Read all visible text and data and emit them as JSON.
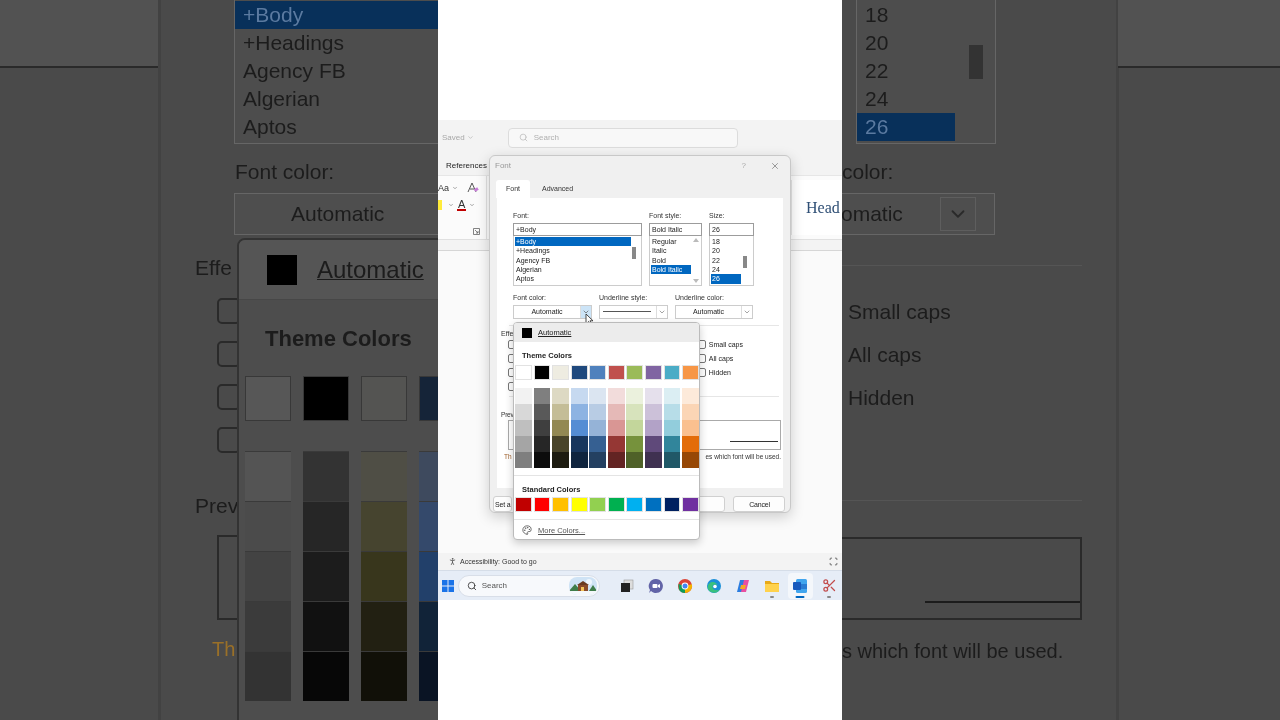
{
  "zoom_left": {
    "font_list": [
      {
        "label": "+Body",
        "selected": true
      },
      {
        "label": "+Headings",
        "selected": false
      },
      {
        "label": "Agency FB",
        "selected": false
      },
      {
        "label": "Algerian",
        "selected": false
      },
      {
        "label": "Aptos",
        "selected": false
      }
    ],
    "font_color_label": "Font color:",
    "font_color_value": "Automatic",
    "effects_label": "Effe",
    "checkboxes": [
      {
        "checked": false
      },
      {
        "checked": false
      },
      {
        "checked": false
      },
      {
        "checked": false
      }
    ],
    "preview_label": "Prev",
    "note_start": "Th",
    "menu": {
      "automatic": {
        "label": "Automatic",
        "color": "#000000"
      },
      "theme_title": "Theme Colors",
      "theme_colors": [
        {
          "color": "#575757",
          "shades": [
            {
              "color": "#545454"
            },
            {
              "color": "#4b4b4b"
            },
            {
              "color": "#434343"
            },
            {
              "color": "#3b3b3b"
            },
            {
              "color": "#333333"
            }
          ]
        },
        {
          "color": "#000000",
          "shades": [
            {
              "color": "#333333"
            },
            {
              "color": "#262626"
            },
            {
              "color": "#1c1c1c"
            },
            {
              "color": "#111111"
            },
            {
              "color": "#070707"
            }
          ]
        },
        {
          "color": "#545452",
          "shades": [
            {
              "color": "#4f4e45"
            },
            {
              "color": "#46442f"
            },
            {
              "color": "#38361c"
            },
            {
              "color": "#222012"
            },
            {
              "color": "#111008"
            }
          ]
        },
        {
          "color": "#152438",
          "shades": [
            {
              "color": "#3e4a5e"
            },
            {
              "color": "#34496b"
            },
            {
              "color": "#22406a"
            },
            {
              "color": "#112338"
            },
            {
              "color": "#0a1424"
            }
          ]
        }
      ]
    }
  },
  "word": {
    "title_bar": {
      "save_status": "Saved",
      "search": {
        "placeholder": "Search"
      }
    },
    "ribbon": {
      "tab": "References",
      "change_case": "Aa",
      "font_color_glyph": "A",
      "style_sample": "Head"
    },
    "status_bar": {
      "accessibility": "Accessibility: Good to go"
    }
  },
  "font_dialog": {
    "title": "Font",
    "help": "?",
    "tabs": [
      {
        "label": "Font",
        "selected": true
      },
      {
        "label": "Advanced",
        "selected": false
      }
    ],
    "font": {
      "label": "Font:",
      "value": "+Body",
      "items": [
        {
          "label": "+Body",
          "selected": true
        },
        {
          "label": "+Headings",
          "selected": false
        },
        {
          "label": "Agency FB",
          "selected": false
        },
        {
          "label": "Algerian",
          "selected": false
        },
        {
          "label": "Aptos",
          "selected": false
        }
      ]
    },
    "font_style": {
      "label": "Font style:",
      "value": "Bold Italic",
      "items": [
        {
          "label": "Regular",
          "selected": false
        },
        {
          "label": "Italic",
          "selected": false
        },
        {
          "label": "Bold",
          "selected": false
        },
        {
          "label": "Bold Italic",
          "selected": true
        }
      ]
    },
    "size": {
      "label": "Size:",
      "value": "26",
      "items": [
        {
          "label": "18",
          "selected": false
        },
        {
          "label": "20",
          "selected": false
        },
        {
          "label": "22",
          "selected": false
        },
        {
          "label": "24",
          "selected": false
        },
        {
          "label": "26",
          "selected": true
        }
      ]
    },
    "font_color": {
      "label": "Font color:",
      "value": "Automatic"
    },
    "underline_style": {
      "label": "Underline style:"
    },
    "underline_color": {
      "label": "Underline color:",
      "value": "Automatic"
    },
    "effects": {
      "label": "Effe",
      "left_checkboxes": [
        {
          "checked": false
        },
        {
          "checked": false
        },
        {
          "checked": false
        },
        {
          "checked": false
        }
      ],
      "options": [
        {
          "label": "Small caps",
          "checked": false
        },
        {
          "label": "All caps",
          "checked": false
        },
        {
          "label": "Hidden",
          "checked": false
        }
      ]
    },
    "preview": {
      "label": "Prev",
      "note_start": "Th",
      "note_end": "es which font will be used."
    },
    "buttons": [
      {
        "label": "Set a",
        "kind": "left"
      },
      {
        "kind": "hidden"
      },
      {
        "label": "Cancel",
        "kind": "right"
      }
    ]
  },
  "color_menu": {
    "automatic": {
      "label": "Automatic",
      "color": "#000000"
    },
    "theme_title": "Theme Colors",
    "theme_colors": [
      {
        "color": "#ffffff",
        "shades": [
          {
            "color": "#f2f2f2"
          },
          {
            "color": "#d8d8d8"
          },
          {
            "color": "#bfbfbf"
          },
          {
            "color": "#a5a5a5"
          },
          {
            "color": "#7f7f7f"
          }
        ]
      },
      {
        "color": "#000000",
        "shades": [
          {
            "color": "#7f7f7f"
          },
          {
            "color": "#595959"
          },
          {
            "color": "#3f3f3f"
          },
          {
            "color": "#262626"
          },
          {
            "color": "#0c0c0c"
          }
        ]
      },
      {
        "color": "#eeece1",
        "shades": [
          {
            "color": "#ddd9c3"
          },
          {
            "color": "#c4bd97"
          },
          {
            "color": "#938953"
          },
          {
            "color": "#494429"
          },
          {
            "color": "#1d1b10"
          }
        ]
      },
      {
        "color": "#1f497d",
        "shades": [
          {
            "color": "#c6d9f0"
          },
          {
            "color": "#8db3e2"
          },
          {
            "color": "#548dd4"
          },
          {
            "color": "#17365d"
          },
          {
            "color": "#0f243e"
          }
        ]
      },
      {
        "color": "#4f81bd",
        "shades": [
          {
            "color": "#dbe5f1"
          },
          {
            "color": "#b8cce4"
          },
          {
            "color": "#95b3d7"
          },
          {
            "color": "#366092"
          },
          {
            "color": "#244061"
          }
        ]
      },
      {
        "color": "#c0504d",
        "shades": [
          {
            "color": "#f2dcdb"
          },
          {
            "color": "#e5b9b7"
          },
          {
            "color": "#d99694"
          },
          {
            "color": "#953734"
          },
          {
            "color": "#632423"
          }
        ]
      },
      {
        "color": "#9bbb59",
        "shades": [
          {
            "color": "#ebf1dd"
          },
          {
            "color": "#d7e3bc"
          },
          {
            "color": "#c3d69b"
          },
          {
            "color": "#76923c"
          },
          {
            "color": "#4f6128"
          }
        ]
      },
      {
        "color": "#8064a2",
        "shades": [
          {
            "color": "#e5e0ec"
          },
          {
            "color": "#ccc1d9"
          },
          {
            "color": "#b2a2c7"
          },
          {
            "color": "#5f497a"
          },
          {
            "color": "#3f3151"
          }
        ]
      },
      {
        "color": "#4bacc6",
        "shades": [
          {
            "color": "#dbeef3"
          },
          {
            "color": "#b7dde8"
          },
          {
            "color": "#92cddc"
          },
          {
            "color": "#31859b"
          },
          {
            "color": "#205867"
          }
        ]
      },
      {
        "color": "#f79646",
        "shades": [
          {
            "color": "#fdeada"
          },
          {
            "color": "#fbd5b5"
          },
          {
            "color": "#fac08f"
          },
          {
            "color": "#e36c09"
          },
          {
            "color": "#974806"
          }
        ]
      }
    ],
    "standard_title": "Standard Colors",
    "standard_colors": [
      {
        "color": "#c00000"
      },
      {
        "color": "#ff0000"
      },
      {
        "color": "#ffc000"
      },
      {
        "color": "#ffff00"
      },
      {
        "color": "#92d050"
      },
      {
        "color": "#00b050"
      },
      {
        "color": "#00b0f0"
      },
      {
        "color": "#0070c0"
      },
      {
        "color": "#002060"
      },
      {
        "color": "#7030a0"
      }
    ],
    "more": "More Colors..."
  },
  "zoom_right": {
    "size_list": [
      {
        "label": "18",
        "selected": false
      },
      {
        "label": "20",
        "selected": false
      },
      {
        "label": "22",
        "selected": false
      },
      {
        "label": "24",
        "selected": false
      },
      {
        "label": "26",
        "selected": true
      }
    ],
    "color_label": "color:",
    "color_value": "omatic",
    "options": [
      {
        "label": "Small caps"
      },
      {
        "label": "All caps"
      },
      {
        "label": "Hidden"
      }
    ],
    "note_end": "s which font will be used."
  },
  "taskbar": {
    "search": {
      "placeholder": "Search"
    },
    "apps": [
      {
        "kind": "task-view",
        "running": false,
        "selected": false
      },
      {
        "kind": "meet",
        "running": false,
        "selected": false
      },
      {
        "kind": "chrome",
        "running": false,
        "selected": false
      },
      {
        "kind": "edge",
        "running": false,
        "selected": false
      },
      {
        "kind": "copilot",
        "running": false,
        "selected": false
      },
      {
        "kind": "folder",
        "running": true,
        "selected": false
      },
      {
        "kind": "word",
        "running": true,
        "selected": true
      },
      {
        "kind": "snipping",
        "running": true,
        "selected": false
      }
    ]
  }
}
